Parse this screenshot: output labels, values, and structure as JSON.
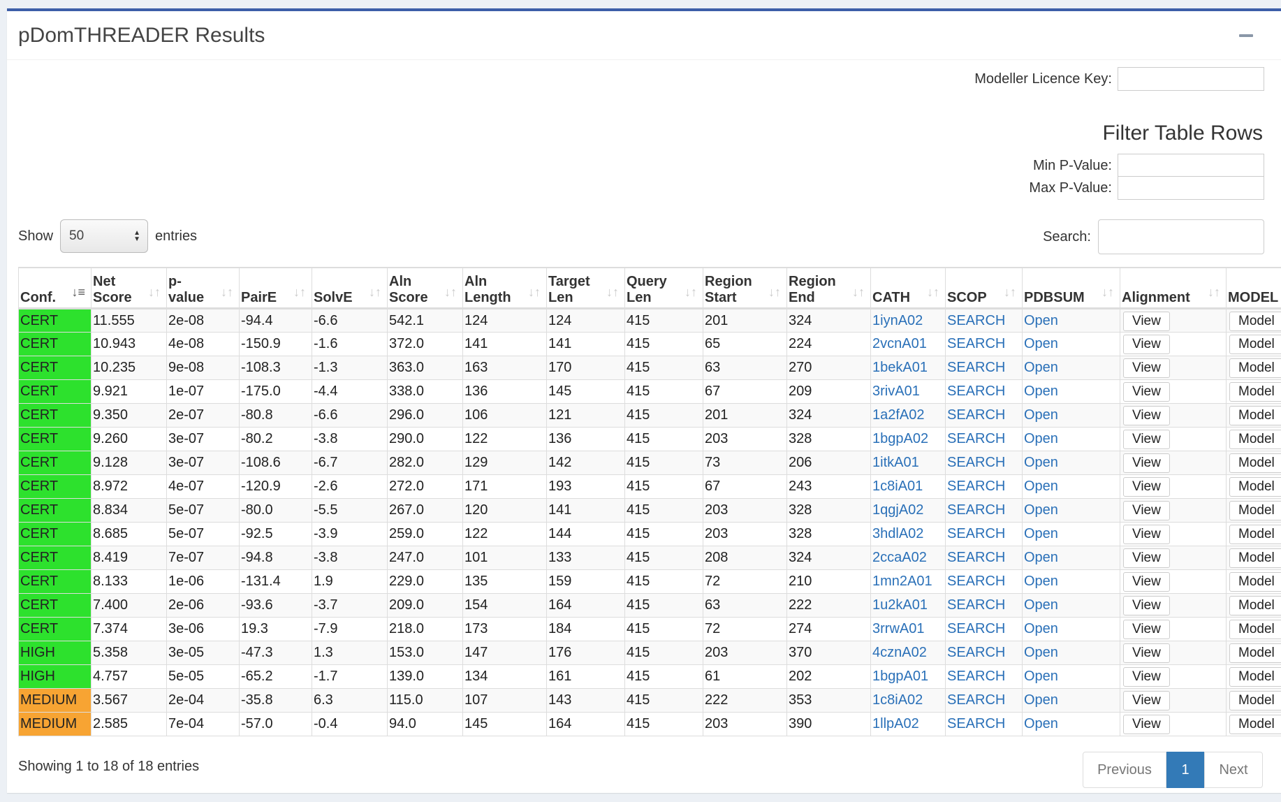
{
  "panel": {
    "title": "pDomTHREADER Results"
  },
  "modeller": {
    "label": "Modeller Licence Key:",
    "value": ""
  },
  "filter": {
    "title": "Filter Table Rows",
    "min_label": "Min P-Value:",
    "max_label": "Max P-Value:"
  },
  "length": {
    "show": "Show",
    "value": "50",
    "entries": "entries"
  },
  "search": {
    "label": "Search:",
    "value": ""
  },
  "table": {
    "headers": [
      [
        "Conf.",
        ""
      ],
      [
        "Net",
        "Score"
      ],
      [
        "p-",
        "value"
      ],
      [
        "PairE",
        ""
      ],
      [
        "SolvE",
        ""
      ],
      [
        "Aln",
        "Score"
      ],
      [
        "Aln",
        "Length"
      ],
      [
        "Target",
        "Len"
      ],
      [
        "Query",
        "Len"
      ],
      [
        "Region",
        "Start"
      ],
      [
        "Region",
        "End"
      ],
      [
        "CATH",
        ""
      ],
      [
        "SCOP",
        ""
      ],
      [
        "PDBSUM",
        ""
      ],
      [
        "Alignment",
        ""
      ],
      [
        "MODEL",
        ""
      ]
    ],
    "rows": [
      [
        "CERT",
        "11.555",
        "2e-08",
        "-94.4",
        "-6.6",
        "542.1",
        "124",
        "124",
        "415",
        "201",
        "324",
        "1iynA02",
        "SEARCH",
        "Open",
        "View",
        "Model"
      ],
      [
        "CERT",
        "10.943",
        "4e-08",
        "-150.9",
        "-1.6",
        "372.0",
        "141",
        "141",
        "415",
        "65",
        "224",
        "2vcnA01",
        "SEARCH",
        "Open",
        "View",
        "Model"
      ],
      [
        "CERT",
        "10.235",
        "9e-08",
        "-108.3",
        "-1.3",
        "363.0",
        "163",
        "170",
        "415",
        "63",
        "270",
        "1bekA01",
        "SEARCH",
        "Open",
        "View",
        "Model"
      ],
      [
        "CERT",
        "9.921",
        "1e-07",
        "-175.0",
        "-4.4",
        "338.0",
        "136",
        "145",
        "415",
        "67",
        "209",
        "3rivA01",
        "SEARCH",
        "Open",
        "View",
        "Model"
      ],
      [
        "CERT",
        "9.350",
        "2e-07",
        "-80.8",
        "-6.6",
        "296.0",
        "106",
        "121",
        "415",
        "201",
        "324",
        "1a2fA02",
        "SEARCH",
        "Open",
        "View",
        "Model"
      ],
      [
        "CERT",
        "9.260",
        "3e-07",
        "-80.2",
        "-3.8",
        "290.0",
        "122",
        "136",
        "415",
        "203",
        "328",
        "1bgpA02",
        "SEARCH",
        "Open",
        "View",
        "Model"
      ],
      [
        "CERT",
        "9.128",
        "3e-07",
        "-108.6",
        "-6.7",
        "282.0",
        "129",
        "142",
        "415",
        "73",
        "206",
        "1itkA01",
        "SEARCH",
        "Open",
        "View",
        "Model"
      ],
      [
        "CERT",
        "8.972",
        "4e-07",
        "-120.9",
        "-2.6",
        "272.0",
        "171",
        "193",
        "415",
        "67",
        "243",
        "1c8iA01",
        "SEARCH",
        "Open",
        "View",
        "Model"
      ],
      [
        "CERT",
        "8.834",
        "5e-07",
        "-80.0",
        "-5.5",
        "267.0",
        "120",
        "141",
        "415",
        "203",
        "328",
        "1qgjA02",
        "SEARCH",
        "Open",
        "View",
        "Model"
      ],
      [
        "CERT",
        "8.685",
        "5e-07",
        "-92.5",
        "-3.9",
        "259.0",
        "122",
        "144",
        "415",
        "203",
        "328",
        "3hdlA02",
        "SEARCH",
        "Open",
        "View",
        "Model"
      ],
      [
        "CERT",
        "8.419",
        "7e-07",
        "-94.8",
        "-3.8",
        "247.0",
        "101",
        "133",
        "415",
        "208",
        "324",
        "2ccaA02",
        "SEARCH",
        "Open",
        "View",
        "Model"
      ],
      [
        "CERT",
        "8.133",
        "1e-06",
        "-131.4",
        "1.9",
        "229.0",
        "135",
        "159",
        "415",
        "72",
        "210",
        "1mn2A01",
        "SEARCH",
        "Open",
        "View",
        "Model"
      ],
      [
        "CERT",
        "7.400",
        "2e-06",
        "-93.6",
        "-3.7",
        "209.0",
        "154",
        "164",
        "415",
        "63",
        "222",
        "1u2kA01",
        "SEARCH",
        "Open",
        "View",
        "Model"
      ],
      [
        "CERT",
        "7.374",
        "3e-06",
        "19.3",
        "-7.9",
        "218.0",
        "173",
        "184",
        "415",
        "72",
        "274",
        "3rrwA01",
        "SEARCH",
        "Open",
        "View",
        "Model"
      ],
      [
        "HIGH",
        "5.358",
        "3e-05",
        "-47.3",
        "1.3",
        "153.0",
        "147",
        "176",
        "415",
        "203",
        "370",
        "4cznA02",
        "SEARCH",
        "Open",
        "View",
        "Model"
      ],
      [
        "HIGH",
        "4.757",
        "5e-05",
        "-65.2",
        "-1.7",
        "139.0",
        "134",
        "161",
        "415",
        "61",
        "202",
        "1bgpA01",
        "SEARCH",
        "Open",
        "View",
        "Model"
      ],
      [
        "MEDIUM",
        "3.567",
        "2e-04",
        "-35.8",
        "6.3",
        "115.0",
        "107",
        "143",
        "415",
        "222",
        "353",
        "1c8iA02",
        "SEARCH",
        "Open",
        "View",
        "Model"
      ],
      [
        "MEDIUM",
        "2.585",
        "7e-04",
        "-57.0",
        "-0.4",
        "94.0",
        "145",
        "164",
        "415",
        "203",
        "390",
        "1llpA02",
        "SEARCH",
        "Open",
        "View",
        "Model"
      ]
    ]
  },
  "colors": {
    "cert_high": "#2de12d",
    "medium": "#f7a433",
    "link": "#2a70b8",
    "accent": "#3c5ea8"
  },
  "footer": {
    "info": "Showing 1 to 18 of 18 entries",
    "prev": "Previous",
    "page": "1",
    "next": "Next"
  }
}
